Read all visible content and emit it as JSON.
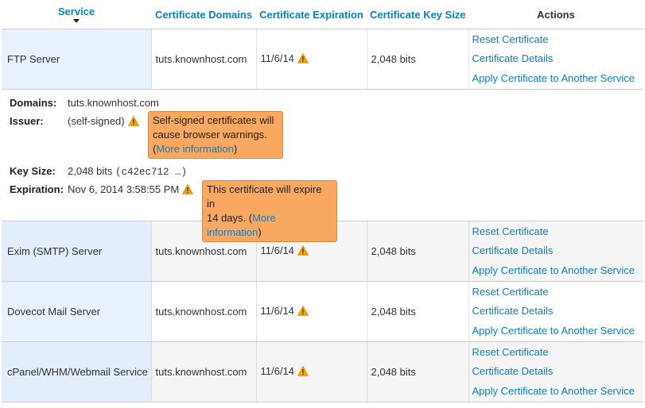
{
  "header": {
    "service": "Service",
    "domains": "Certificate Domains",
    "expiration": "Certificate Expiration",
    "key_size": "Certificate Key Size",
    "actions": "Actions"
  },
  "rows": [
    {
      "service": "FTP Server",
      "domain": "tuts.knownhost.com",
      "expiration": "11/6/14",
      "key_size": "2,048 bits"
    },
    {
      "service": "Exim (SMTP) Server",
      "domain": "tuts.knownhost.com",
      "expiration": "11/6/14",
      "key_size": "2,048 bits"
    },
    {
      "service": "Dovecot Mail Server",
      "domain": "tuts.knownhost.com",
      "expiration": "11/6/14",
      "key_size": "2,048 bits"
    },
    {
      "service": "cPanel/WHM/Webmail Service",
      "domain": "tuts.knownhost.com",
      "expiration": "11/6/14",
      "key_size": "2,048 bits"
    }
  ],
  "actions": {
    "reset": "Reset Certificate",
    "details": "Certificate Details",
    "apply": "Apply Certificate to Another Service"
  },
  "detail": {
    "domains_label": "Domains:",
    "domains_value": "tuts.knownhost.com",
    "issuer_label": "Issuer:",
    "issuer_value": "(self-signed)",
    "issuer_warning_line1": "Self-signed certificates will",
    "issuer_warning_line2": "cause browser warnings.",
    "issuer_more_open": "(",
    "issuer_more_link": "More information",
    "issuer_more_close": ")",
    "key_label": "Key Size:",
    "key_value": "2,048 bits",
    "key_hash": "(c42ec712 …)",
    "expiration_label": "Expiration:",
    "expiration_value": "Nov 6, 2014 3:58:55 PM",
    "expire_warning_line1": "This certificate will expire in",
    "expire_warning_line2": "14 days. (",
    "expire_more_link": "More information",
    "expire_more_close": ")"
  },
  "colors": {
    "link": "#0a7fc5",
    "warning_bg": "#f9a862",
    "warning_icon": "#f0a30a",
    "service_cell_bg": "#e8f2fd"
  }
}
